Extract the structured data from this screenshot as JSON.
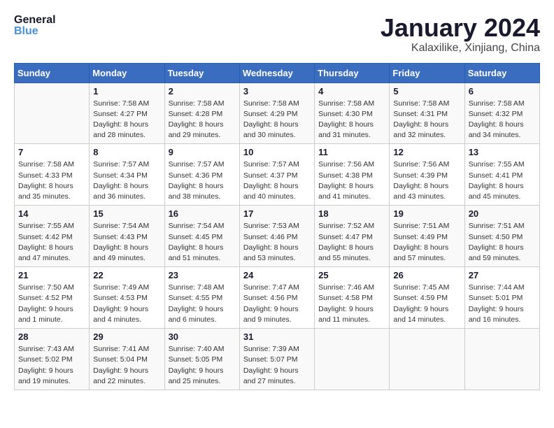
{
  "header": {
    "logo_line1": "General",
    "logo_line2": "Blue",
    "month_title": "January 2024",
    "location": "Kalaxilike, Xinjiang, China"
  },
  "weekdays": [
    "Sunday",
    "Monday",
    "Tuesday",
    "Wednesday",
    "Thursday",
    "Friday",
    "Saturday"
  ],
  "weeks": [
    [
      {
        "day": "",
        "sunrise": "",
        "sunset": "",
        "daylight": ""
      },
      {
        "day": "1",
        "sunrise": "Sunrise: 7:58 AM",
        "sunset": "Sunset: 4:27 PM",
        "daylight": "Daylight: 8 hours and 28 minutes."
      },
      {
        "day": "2",
        "sunrise": "Sunrise: 7:58 AM",
        "sunset": "Sunset: 4:28 PM",
        "daylight": "Daylight: 8 hours and 29 minutes."
      },
      {
        "day": "3",
        "sunrise": "Sunrise: 7:58 AM",
        "sunset": "Sunset: 4:29 PM",
        "daylight": "Daylight: 8 hours and 30 minutes."
      },
      {
        "day": "4",
        "sunrise": "Sunrise: 7:58 AM",
        "sunset": "Sunset: 4:30 PM",
        "daylight": "Daylight: 8 hours and 31 minutes."
      },
      {
        "day": "5",
        "sunrise": "Sunrise: 7:58 AM",
        "sunset": "Sunset: 4:31 PM",
        "daylight": "Daylight: 8 hours and 32 minutes."
      },
      {
        "day": "6",
        "sunrise": "Sunrise: 7:58 AM",
        "sunset": "Sunset: 4:32 PM",
        "daylight": "Daylight: 8 hours and 34 minutes."
      }
    ],
    [
      {
        "day": "7",
        "sunrise": "Sunrise: 7:58 AM",
        "sunset": "Sunset: 4:33 PM",
        "daylight": "Daylight: 8 hours and 35 minutes."
      },
      {
        "day": "8",
        "sunrise": "Sunrise: 7:57 AM",
        "sunset": "Sunset: 4:34 PM",
        "daylight": "Daylight: 8 hours and 36 minutes."
      },
      {
        "day": "9",
        "sunrise": "Sunrise: 7:57 AM",
        "sunset": "Sunset: 4:36 PM",
        "daylight": "Daylight: 8 hours and 38 minutes."
      },
      {
        "day": "10",
        "sunrise": "Sunrise: 7:57 AM",
        "sunset": "Sunset: 4:37 PM",
        "daylight": "Daylight: 8 hours and 40 minutes."
      },
      {
        "day": "11",
        "sunrise": "Sunrise: 7:56 AM",
        "sunset": "Sunset: 4:38 PM",
        "daylight": "Daylight: 8 hours and 41 minutes."
      },
      {
        "day": "12",
        "sunrise": "Sunrise: 7:56 AM",
        "sunset": "Sunset: 4:39 PM",
        "daylight": "Daylight: 8 hours and 43 minutes."
      },
      {
        "day": "13",
        "sunrise": "Sunrise: 7:55 AM",
        "sunset": "Sunset: 4:41 PM",
        "daylight": "Daylight: 8 hours and 45 minutes."
      }
    ],
    [
      {
        "day": "14",
        "sunrise": "Sunrise: 7:55 AM",
        "sunset": "Sunset: 4:42 PM",
        "daylight": "Daylight: 8 hours and 47 minutes."
      },
      {
        "day": "15",
        "sunrise": "Sunrise: 7:54 AM",
        "sunset": "Sunset: 4:43 PM",
        "daylight": "Daylight: 8 hours and 49 minutes."
      },
      {
        "day": "16",
        "sunrise": "Sunrise: 7:54 AM",
        "sunset": "Sunset: 4:45 PM",
        "daylight": "Daylight: 8 hours and 51 minutes."
      },
      {
        "day": "17",
        "sunrise": "Sunrise: 7:53 AM",
        "sunset": "Sunset: 4:46 PM",
        "daylight": "Daylight: 8 hours and 53 minutes."
      },
      {
        "day": "18",
        "sunrise": "Sunrise: 7:52 AM",
        "sunset": "Sunset: 4:47 PM",
        "daylight": "Daylight: 8 hours and 55 minutes."
      },
      {
        "day": "19",
        "sunrise": "Sunrise: 7:51 AM",
        "sunset": "Sunset: 4:49 PM",
        "daylight": "Daylight: 8 hours and 57 minutes."
      },
      {
        "day": "20",
        "sunrise": "Sunrise: 7:51 AM",
        "sunset": "Sunset: 4:50 PM",
        "daylight": "Daylight: 8 hours and 59 minutes."
      }
    ],
    [
      {
        "day": "21",
        "sunrise": "Sunrise: 7:50 AM",
        "sunset": "Sunset: 4:52 PM",
        "daylight": "Daylight: 9 hours and 1 minute."
      },
      {
        "day": "22",
        "sunrise": "Sunrise: 7:49 AM",
        "sunset": "Sunset: 4:53 PM",
        "daylight": "Daylight: 9 hours and 4 minutes."
      },
      {
        "day": "23",
        "sunrise": "Sunrise: 7:48 AM",
        "sunset": "Sunset: 4:55 PM",
        "daylight": "Daylight: 9 hours and 6 minutes."
      },
      {
        "day": "24",
        "sunrise": "Sunrise: 7:47 AM",
        "sunset": "Sunset: 4:56 PM",
        "daylight": "Daylight: 9 hours and 9 minutes."
      },
      {
        "day": "25",
        "sunrise": "Sunrise: 7:46 AM",
        "sunset": "Sunset: 4:58 PM",
        "daylight": "Daylight: 9 hours and 11 minutes."
      },
      {
        "day": "26",
        "sunrise": "Sunrise: 7:45 AM",
        "sunset": "Sunset: 4:59 PM",
        "daylight": "Daylight: 9 hours and 14 minutes."
      },
      {
        "day": "27",
        "sunrise": "Sunrise: 7:44 AM",
        "sunset": "Sunset: 5:01 PM",
        "daylight": "Daylight: 9 hours and 16 minutes."
      }
    ],
    [
      {
        "day": "28",
        "sunrise": "Sunrise: 7:43 AM",
        "sunset": "Sunset: 5:02 PM",
        "daylight": "Daylight: 9 hours and 19 minutes."
      },
      {
        "day": "29",
        "sunrise": "Sunrise: 7:41 AM",
        "sunset": "Sunset: 5:04 PM",
        "daylight": "Daylight: 9 hours and 22 minutes."
      },
      {
        "day": "30",
        "sunrise": "Sunrise: 7:40 AM",
        "sunset": "Sunset: 5:05 PM",
        "daylight": "Daylight: 9 hours and 25 minutes."
      },
      {
        "day": "31",
        "sunrise": "Sunrise: 7:39 AM",
        "sunset": "Sunset: 5:07 PM",
        "daylight": "Daylight: 9 hours and 27 minutes."
      },
      {
        "day": "",
        "sunrise": "",
        "sunset": "",
        "daylight": ""
      },
      {
        "day": "",
        "sunrise": "",
        "sunset": "",
        "daylight": ""
      },
      {
        "day": "",
        "sunrise": "",
        "sunset": "",
        "daylight": ""
      }
    ]
  ]
}
